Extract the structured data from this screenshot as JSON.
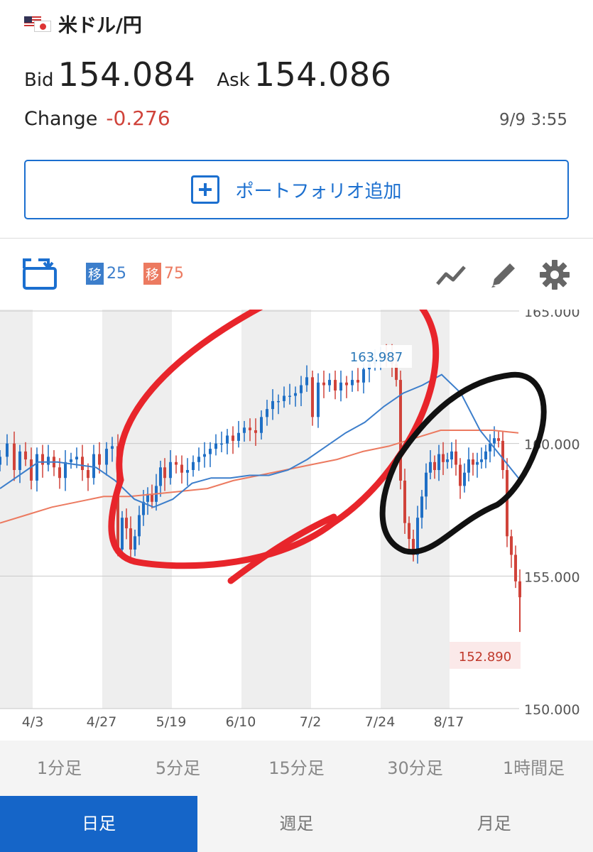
{
  "header": {
    "pair": "米ドル/円",
    "flag_icon": "us-jp-flag-icon",
    "bid_label": "Bid",
    "bid_value": "154.084",
    "ask_label": "Ask",
    "ask_value": "154.086",
    "change_label": "Change",
    "change_value": "-0.276",
    "timestamp": "9/9 3:55",
    "portfolio_button": "ポートフォリオ追加"
  },
  "toolbar": {
    "rotate_icon": "rotate-screen-icon",
    "ma_short_tag": "移",
    "ma_short_period": "25",
    "ma_long_tag": "移",
    "ma_long_period": "75",
    "line_icon": "line-chart-icon",
    "pencil_icon": "pencil-icon",
    "gear_icon": "gear-icon"
  },
  "colors": {
    "accent": "#1b6fcf",
    "up": "#1f6fc5",
    "down": "#d0433a",
    "ma_short": "#3c7ecb",
    "ma_long": "#ec7a60",
    "annotation_red": "#e8252b",
    "annotation_black": "#111111"
  },
  "chart_data": {
    "type": "candlestick",
    "title": "",
    "y_ticks": [
      "165.000",
      "160.000",
      "155.000",
      "150.000"
    ],
    "y_range": [
      150,
      165
    ],
    "x_ticks": [
      "4/3",
      "4/27",
      "5/19",
      "6/10",
      "7/2",
      "7/24",
      "8/17"
    ],
    "high_label": "163.987",
    "low_label": "152.890",
    "series": [
      {
        "period": 25,
        "values": [
          158.3,
          158.8,
          159.3,
          159.3,
          159.2,
          159.1,
          158.6,
          157.9,
          157.6,
          157.9,
          158.5,
          158.7,
          158.7,
          158.8,
          158.8,
          159.0,
          159.4,
          159.9,
          160.4,
          160.8,
          161.4,
          161.9,
          162.2,
          162.6,
          161.9,
          160.5,
          159.6,
          158.7
        ]
      },
      {
        "period": 75,
        "values": [
          157.0,
          157.3,
          157.6,
          157.8,
          158.0,
          158.0,
          158.1,
          158.2,
          158.3,
          158.6,
          158.8,
          159.0,
          159.2,
          159.4,
          159.7,
          159.9,
          160.2,
          160.5,
          160.5,
          160.5,
          160.4
        ]
      }
    ]
  },
  "timeframes": [
    "1分足",
    "5分足",
    "15分足",
    "30分足",
    "1時間足"
  ],
  "periods": [
    "日足",
    "週足",
    "月足"
  ]
}
